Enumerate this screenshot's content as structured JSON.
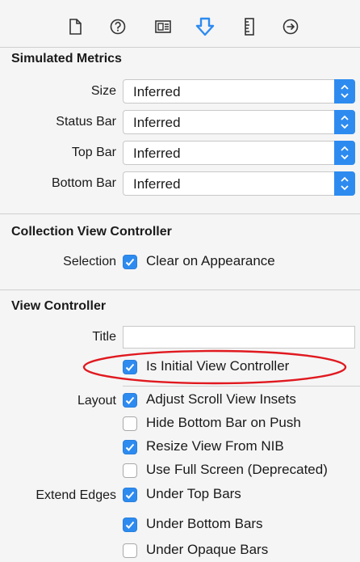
{
  "toolbar": {
    "tabs": [
      {
        "icon": "file-icon",
        "active": false
      },
      {
        "icon": "help-icon",
        "active": false
      },
      {
        "icon": "identity-icon",
        "active": false
      },
      {
        "icon": "attributes-icon",
        "active": true
      },
      {
        "icon": "size-ruler-icon",
        "active": false
      },
      {
        "icon": "connections-arrow-icon",
        "active": false
      }
    ],
    "active_color": "#2d8bf0"
  },
  "simulated_metrics": {
    "title": "Simulated Metrics",
    "rows": [
      {
        "label": "Size",
        "value": "Inferred"
      },
      {
        "label": "Status Bar",
        "value": "Inferred"
      },
      {
        "label": "Top Bar",
        "value": "Inferred"
      },
      {
        "label": "Bottom Bar",
        "value": "Inferred"
      }
    ]
  },
  "collection_view_controller": {
    "title": "Collection View Controller",
    "selection_label": "Selection",
    "clear_on_appearance": {
      "label": "Clear on Appearance",
      "checked": true
    }
  },
  "view_controller": {
    "title": "View Controller",
    "title_field_label": "Title",
    "title_field_value": "",
    "is_initial": {
      "label": "Is Initial View Controller",
      "checked": true
    },
    "layout_label": "Layout",
    "layout_options": [
      {
        "label": "Adjust Scroll View Insets",
        "checked": true
      },
      {
        "label": "Hide Bottom Bar on Push",
        "checked": false
      },
      {
        "label": "Resize View From NIB",
        "checked": true
      },
      {
        "label": "Use Full Screen (Deprecated)",
        "checked": false
      }
    ],
    "extend_edges_label": "Extend Edges",
    "extend_edges_options": [
      {
        "label": "Under Top Bars",
        "checked": true
      },
      {
        "label": "Under Bottom Bars",
        "checked": true
      },
      {
        "label": "Under Opaque Bars",
        "checked": false
      }
    ]
  },
  "colors": {
    "accent": "#2d8bf0",
    "highlight": "#e0191f"
  }
}
